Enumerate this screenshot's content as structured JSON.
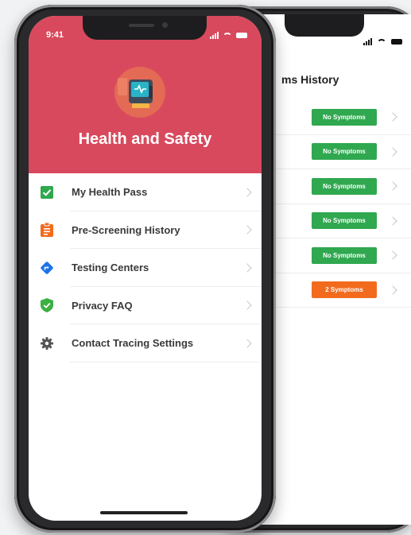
{
  "colors": {
    "header_bg": "#d9495d",
    "badge_green": "#2fa84f",
    "badge_orange": "#f26b1d",
    "check_green": "#2fa84f",
    "clipboard_orange": "#f26b1d",
    "directions_blue": "#1a73e8",
    "shield_green": "#3cb043",
    "gear_gray": "#555555"
  },
  "front": {
    "status_time": "9:41",
    "title": "Health and Safety",
    "app_icon": "monitor-icon",
    "menu": [
      {
        "label": "My Health Pass",
        "icon": "checkbox-icon"
      },
      {
        "label": "Pre-Screening History",
        "icon": "clipboard-icon"
      },
      {
        "label": "Testing Centers",
        "icon": "directions-icon"
      },
      {
        "label": "Privacy FAQ",
        "icon": "shield-check-icon"
      },
      {
        "label": "Contact Tracing Settings",
        "icon": "gear-icon"
      }
    ]
  },
  "back": {
    "title": "ms History",
    "rows": [
      {
        "badge": "No Symptoms",
        "status": "green"
      },
      {
        "badge": "No Symptoms",
        "status": "green"
      },
      {
        "badge": "No Symptoms",
        "status": "green"
      },
      {
        "badge": "No Symptoms",
        "status": "green"
      },
      {
        "badge": "No Symptoms",
        "status": "green"
      },
      {
        "badge": "2 Symptoms",
        "status": "orange"
      }
    ]
  }
}
